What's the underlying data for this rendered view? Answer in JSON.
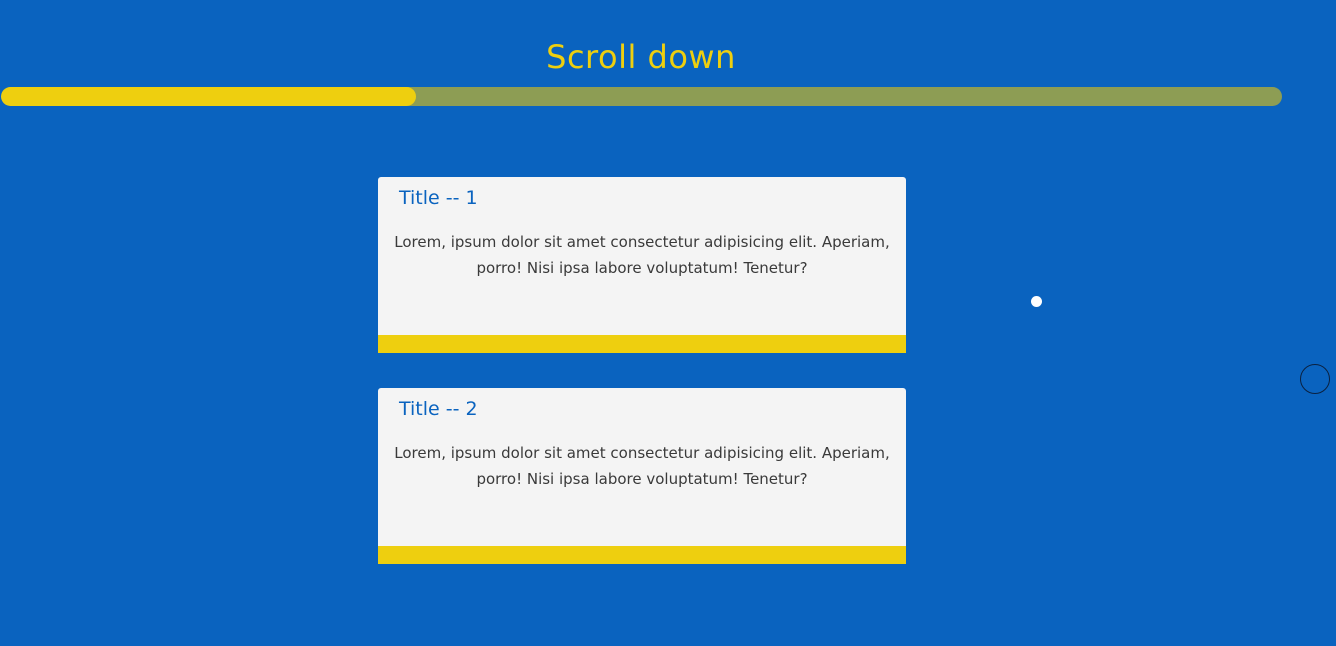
{
  "header": {
    "title": "Scroll down"
  },
  "scroll_progress": {
    "value": 0.324
  },
  "cards": [
    {
      "title": "Title -- 1",
      "text": "Lorem, ipsum dolor sit amet consectetur adipisicing elit. Aperiam, porro! Nisi ipsa labore voluptatum! Tenetur?"
    },
    {
      "title": "Title -- 2",
      "text": "Lorem, ipsum dolor sit amet consectetur adipisicing elit. Aperiam, porro! Nisi ipsa labore voluptatum! Tenetur?"
    }
  ],
  "colors": {
    "background": "#0a63bf",
    "accent": "#eecf0f",
    "track": "#8d9d54",
    "card": "#f4f4f4",
    "card_title": "#0a63bf",
    "card_text": "#3a3a3a"
  }
}
